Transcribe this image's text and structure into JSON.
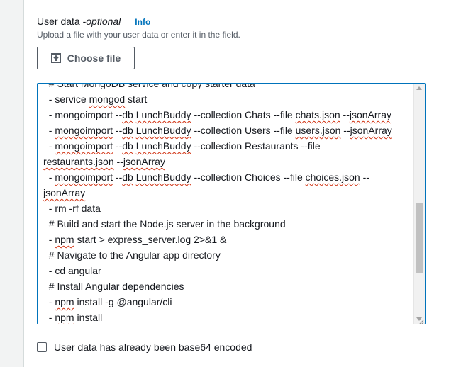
{
  "field": {
    "label": "User data - ",
    "label_optional": "optional",
    "info_link": "Info",
    "description": "Upload a file with your user data or enter it in the field."
  },
  "choose_file_button": {
    "label": "Choose file",
    "icon": "upload-icon"
  },
  "textarea": {
    "lines": [
      [
        {
          "t": "  # Start MongoDB service and copy starter data"
        }
      ],
      [
        {
          "t": "  - service "
        },
        {
          "t": "mongod",
          "sq": true
        },
        {
          "t": " start"
        }
      ],
      [
        {
          "t": "  - mongoimport --"
        },
        {
          "t": "db",
          "sq": true
        },
        {
          "t": " "
        },
        {
          "t": "LunchBuddy",
          "sq": true
        },
        {
          "t": " --collection Chats --file "
        },
        {
          "t": "chats.json",
          "sq": true
        },
        {
          "t": " --"
        },
        {
          "t": "jsonArray",
          "sq": true
        }
      ],
      [
        {
          "t": "  - "
        },
        {
          "t": "mongoimport",
          "sq": true
        },
        {
          "t": " --"
        },
        {
          "t": "db",
          "sq": true
        },
        {
          "t": " "
        },
        {
          "t": "LunchBuddy",
          "sq": true
        },
        {
          "t": " --collection Users --file "
        },
        {
          "t": "users.json",
          "sq": true
        },
        {
          "t": " --"
        },
        {
          "t": "jsonArray",
          "sq": true
        }
      ],
      [
        {
          "t": "  - "
        },
        {
          "t": "mongoimport",
          "sq": true
        },
        {
          "t": " --"
        },
        {
          "t": "db",
          "sq": true
        },
        {
          "t": " "
        },
        {
          "t": "LunchBuddy",
          "sq": true
        },
        {
          "t": " --collection Restaurants --file"
        }
      ],
      [
        {
          "t": "restaurants.json",
          "sq": true
        },
        {
          "t": " --"
        },
        {
          "t": "jsonArray",
          "sq": true
        }
      ],
      [
        {
          "t": "  - "
        },
        {
          "t": "mongoimport",
          "sq": true
        },
        {
          "t": " --"
        },
        {
          "t": "db",
          "sq": true
        },
        {
          "t": " "
        },
        {
          "t": "LunchBuddy",
          "sq": true
        },
        {
          "t": " --collection Choices --file "
        },
        {
          "t": "choices.json",
          "sq": true
        },
        {
          "t": " --"
        }
      ],
      [
        {
          "t": "jsonArray",
          "sq": true
        }
      ],
      [
        {
          "t": "  - rm -rf data"
        }
      ],
      [
        {
          "t": "  # Build and start the Node.js server in the background"
        }
      ],
      [
        {
          "t": "  - "
        },
        {
          "t": "npm",
          "sq": true
        },
        {
          "t": " start > express_server.log 2>&1 &"
        }
      ],
      [
        {
          "t": "  # Navigate to the Angular app directory"
        }
      ],
      [
        {
          "t": "  - cd angular"
        }
      ],
      [
        {
          "t": "  # Install Angular dependencies"
        }
      ],
      [
        {
          "t": "  - "
        },
        {
          "t": "npm",
          "sq": true
        },
        {
          "t": " install -g @angular/cli"
        }
      ],
      [
        {
          "t": "  - "
        },
        {
          "t": "npm",
          "sq": true
        },
        {
          "t": " install"
        }
      ]
    ]
  },
  "checkbox": {
    "label": "User data has already been base64 encoded",
    "checked": false
  },
  "colors": {
    "accent": "#0073bb",
    "text": "#16191f",
    "secondary": "#545b64",
    "spellcheck": "#d13212"
  }
}
